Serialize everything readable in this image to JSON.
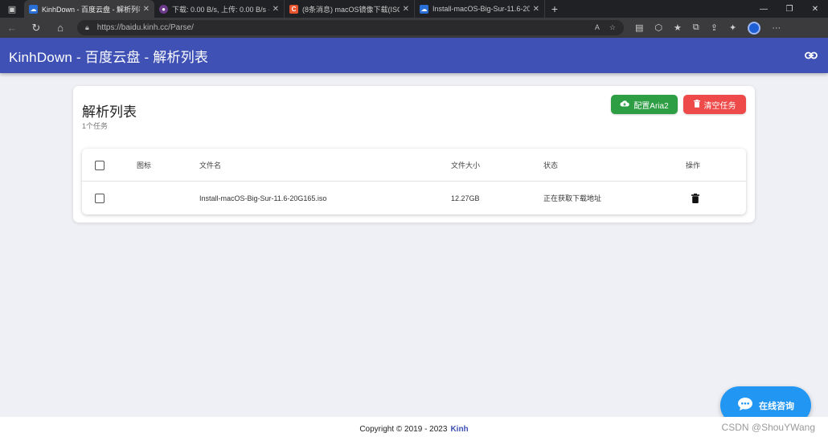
{
  "browser": {
    "tabs": [
      {
        "title": "KinhDown - 百度云盘 - 解析列表",
        "favicon": "baidu-cloud-icon",
        "active": true
      },
      {
        "title": "下载: 0.00 B/s, 上传: 0.00 B/s · Ar",
        "favicon": "aria-icon",
        "active": false
      },
      {
        "title": "(8条消息) macOS镜像下载(ISO、",
        "favicon": "csdn-icon",
        "active": false
      },
      {
        "title": "Install-macOS-Big-Sur-11.6-20G",
        "favicon": "baidu-cloud-icon",
        "active": false
      }
    ],
    "url": "https://baidu.kinh.cc/Parse/",
    "colors": {
      "chrome_dark": "#202124",
      "chrome_mid": "#3b3b3d"
    }
  },
  "app": {
    "title": "KinhDown - 百度云盘 - 解析列表",
    "header_color": "#3f51b5"
  },
  "card": {
    "title": "解析列表",
    "subtitle": "1个任务",
    "buttons": {
      "aria": {
        "label": "配置Aria2",
        "icon": "cloud-icon",
        "color": "#2e9e44"
      },
      "clear": {
        "label": "清空任务",
        "icon": "trash-icon",
        "color": "#ee4a4a"
      }
    }
  },
  "table": {
    "columns": [
      "图标",
      "文件名",
      "文件大小",
      "状态",
      "操作"
    ],
    "rows": [
      {
        "icon": "",
        "filename": "Install-macOS-Big-Sur-11.6-20G165.iso",
        "size": "12.27GB",
        "status": "正在获取下载地址",
        "action_icon": "trash-icon"
      }
    ]
  },
  "footer": {
    "copyright": "Copyright © 2019 - 2023",
    "brand": "Kinh"
  },
  "chat": {
    "label": "在线咨询",
    "icon": "chat-bubble-icon",
    "color": "#2196f3"
  },
  "watermark": "CSDN @ShouYWang"
}
